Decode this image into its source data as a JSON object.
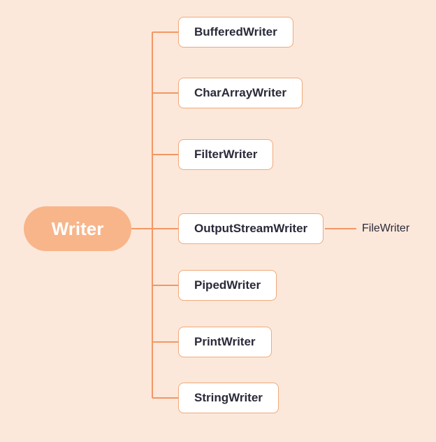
{
  "root": {
    "label": "Writer"
  },
  "children": [
    {
      "label": "BufferedWriter"
    },
    {
      "label": "CharArrayWriter"
    },
    {
      "label": "FilterWriter"
    },
    {
      "label": "OutputStreamWriter"
    },
    {
      "label": "PipedWriter"
    },
    {
      "label": "PrintWriter"
    },
    {
      "label": "StringWriter"
    }
  ],
  "grandchild": {
    "label": "FileWriter"
  },
  "colors": {
    "background": "#fce8da",
    "root_fill": "#f8b58a",
    "node_border": "#f0a97a",
    "connector": "#f29765"
  }
}
